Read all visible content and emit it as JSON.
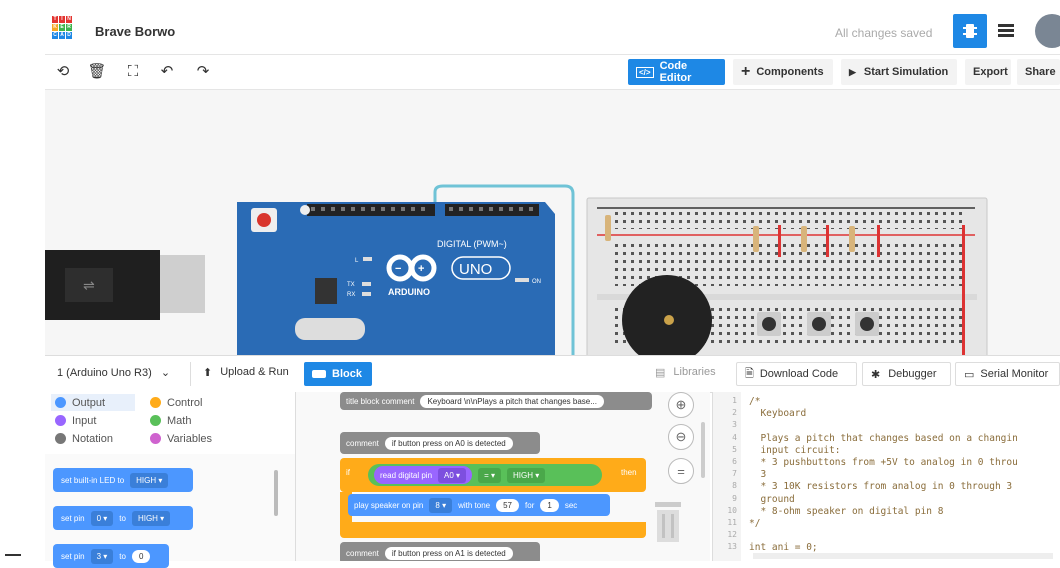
{
  "header": {
    "logo_letters": [
      "T",
      "I",
      "N",
      "K",
      "E",
      "R",
      "C",
      "A",
      "D"
    ],
    "project_name": "Brave Borwo",
    "status": "All changes saved"
  },
  "toolbar": {
    "code_editor": "Code Editor",
    "components": "Components",
    "start_simulation": "Start Simulation",
    "export": "Export",
    "share": "Share"
  },
  "board": {
    "digital_label": "DIGITAL (PWM~)",
    "brand": "ARDUINO",
    "model": "UNO",
    "on_label": "ON",
    "l_label": "L",
    "tx_label": "TX",
    "rx_label": "RX"
  },
  "codebar": {
    "device_select": "1 (Arduino Uno R3)",
    "upload_run": "Upload & Run",
    "block": "Block",
    "libraries": "Libraries",
    "download_code": "Download Code",
    "debugger": "Debugger",
    "serial_monitor": "Serial Monitor"
  },
  "categories": [
    {
      "label": "Output",
      "color": "#4c97ff"
    },
    {
      "label": "Control",
      "color": "#ffab19"
    },
    {
      "label": "Input",
      "color": "#9966ff"
    },
    {
      "label": "Math",
      "color": "#59c059"
    },
    {
      "label": "Notation",
      "color": "#777777"
    },
    {
      "label": "Variables",
      "color": "#cf63cf"
    }
  ],
  "palette_blocks": {
    "b1_text": "set built-in LED to",
    "b1_value": "HIGH ▾",
    "b2_text": "set pin",
    "b2_pin": "0 ▾",
    "b2_to": "to",
    "b2_value": "HIGH ▾",
    "b3_text": "set pin",
    "b3_pin": "3 ▾",
    "b3_to": "to",
    "b3_value": "0"
  },
  "workspace": {
    "title_comment_label": "title block comment",
    "title_comment_value": "Keyboard  \\n\\nPlays a pitch that changes base...",
    "comment_label": "comment",
    "comment1_value": "if button press on A0 is detected",
    "if_label": "if",
    "read_pin_label": "read digital pin",
    "read_pin_value": "A0 ▾",
    "eq_value": "= ▾",
    "high_value": "HIGH ▾",
    "then_label": "then",
    "play_label": "play speaker on pin",
    "play_pin": "8 ▾",
    "tone_label": "with tone",
    "tone_value": "57",
    "for_label": "for",
    "for_value": "1",
    "sec_label": "sec",
    "comment2_value": "if button press on A1 is detected"
  },
  "code_lines": [
    {
      "n": "1",
      "t": "/*"
    },
    {
      "n": "2",
      "t": "  Keyboard"
    },
    {
      "n": "3",
      "t": ""
    },
    {
      "n": "4",
      "t": "  Plays a pitch that changes based on a changin"
    },
    {
      "n": "5",
      "t": "  input circuit:"
    },
    {
      "n": "6",
      "t": "  * 3 pushbuttons from +5V to analog in 0 throu"
    },
    {
      "n": "7",
      "t": "  3"
    },
    {
      "n": "8",
      "t": "  * 3 10K resistors from analog in 0 through 3"
    },
    {
      "n": "9",
      "t": "  ground"
    },
    {
      "n": "10",
      "t": "  * 8-ohm speaker on digital pin 8"
    },
    {
      "n": "11",
      "t": "*/"
    },
    {
      "n": "12",
      "t": ""
    },
    {
      "n": "13",
      "t": "int ani = 0;"
    }
  ],
  "colors": {
    "primary_blue": "#1e88e5",
    "board_blue": "#2a6bb5",
    "wire_teal": "#6fc3d6",
    "control_orange": "#ffab19",
    "math_green": "#59c059",
    "output_blue": "#4c97ff",
    "comment_gray": "#8c8c8c"
  }
}
